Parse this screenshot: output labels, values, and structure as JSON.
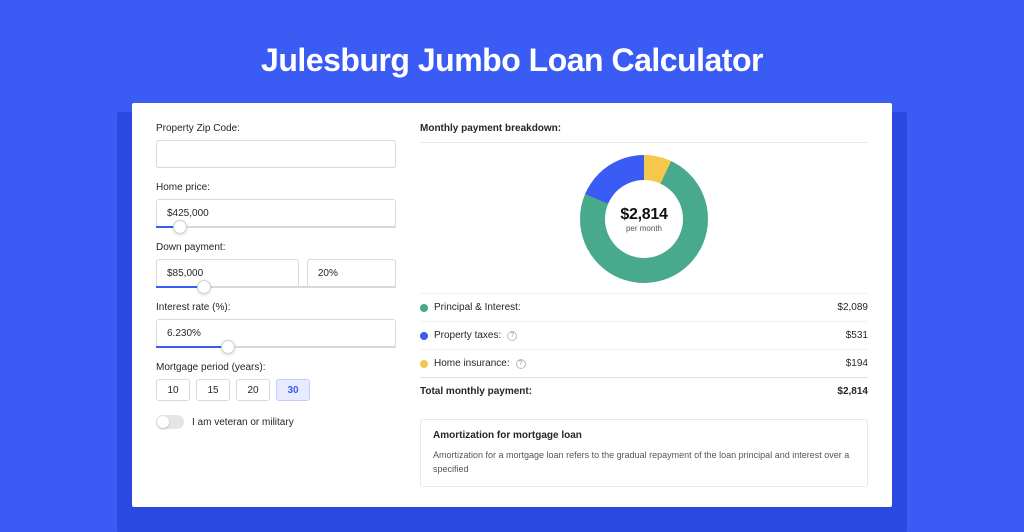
{
  "title": "Julesburg Jumbo Loan Calculator",
  "form": {
    "zip_label": "Property Zip Code:",
    "zip_value": "",
    "home_price_label": "Home price:",
    "home_price_value": "$425,000",
    "home_price_slider_pct": 10,
    "down_payment_label": "Down payment:",
    "down_payment_value": "$85,000",
    "down_payment_pct": "20%",
    "down_payment_slider_pct": 20,
    "interest_label": "Interest rate (%):",
    "interest_value": "6.230%",
    "interest_slider_pct": 30,
    "period_label": "Mortgage period (years):",
    "period_options": [
      "10",
      "15",
      "20",
      "30"
    ],
    "period_selected": "30",
    "veteran_label": "I am veteran or military"
  },
  "breakdown": {
    "title": "Monthly payment breakdown:",
    "center_value": "$2,814",
    "center_label": "per month",
    "items": [
      {
        "color": "green",
        "label": "Principal & Interest:",
        "value": "$2,089",
        "info": false
      },
      {
        "color": "blue",
        "label": "Property taxes:",
        "value": "$531",
        "info": true
      },
      {
        "color": "yellow",
        "label": "Home insurance:",
        "value": "$194",
        "info": true
      }
    ],
    "total_label": "Total monthly payment:",
    "total_value": "$2,814"
  },
  "amortization": {
    "title": "Amortization for mortgage loan",
    "body": "Amortization for a mortgage loan refers to the gradual repayment of the loan principal and interest over a specified"
  },
  "chart_data": {
    "type": "pie",
    "title": "Monthly payment breakdown",
    "series": [
      {
        "name": "Principal & Interest",
        "value": 2089,
        "color": "#49a98d"
      },
      {
        "name": "Property taxes",
        "value": 531,
        "color": "#3b5bf5"
      },
      {
        "name": "Home insurance",
        "value": 194,
        "color": "#f5c84b"
      }
    ],
    "total": 2814,
    "center_label": "per month"
  }
}
